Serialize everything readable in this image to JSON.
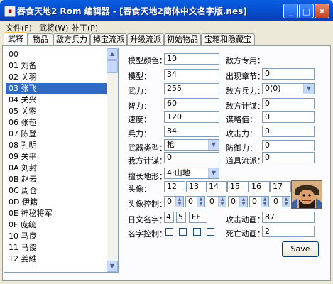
{
  "window": {
    "title": "吞食天地2 Rom 编辑器 - [吞食天地2简体中文名字版.nes]"
  },
  "menu": [
    "文件(F)",
    "武将(W)",
    "补丁(P)"
  ],
  "tabs": [
    "武将",
    "物品",
    "敌方兵力",
    "掉宝流派",
    "升级流派",
    "初始物品",
    "宝箱和隐藏宝物"
  ],
  "generals": [
    "00",
    "01 刘备",
    "02 关羽",
    "03 张飞",
    "04 关兴",
    "05 关索",
    "06 张苞",
    "07 陈登",
    "08 孔明",
    "09 关平",
    "0A 刘封",
    "0B 赵云",
    "0C 周仓",
    "0D 伊籍",
    "0E 神秘将军",
    "0F 庞统",
    "10 马良",
    "11 马谡",
    "12 姜維"
  ],
  "selected_general": "03 张飞",
  "form": {
    "model_color_label": "模型颜色：",
    "model_color": "10",
    "model_label": "模型：",
    "model": "34",
    "force_label": "武力：",
    "force": "255",
    "intel_label": "智力：",
    "intel": "60",
    "speed_label": "速度：",
    "speed": "120",
    "troops_label": "兵力：",
    "troops": "84",
    "weapon_type_label": "武器类型：",
    "weapon_type": "枪",
    "our_tactic_label": "我方计谋：",
    "our_tactic": "0",
    "terrain_label": "擅长地形：",
    "terrain": "4:山地",
    "enemy_only_label": "敌方专用：",
    "chapter_label": "出现章节：",
    "chapter": "0",
    "enemy_troops_label": "敌方兵力：",
    "enemy_troops": "0(0)",
    "enemy_tactic_label": "敌方计谋：",
    "enemy_tactic": "0",
    "strategy_label": "谋略值：",
    "strategy": "0",
    "attack_label": "攻击力：",
    "attack": "0",
    "defense_label": "防御力：",
    "defense": "0",
    "item_flow_label": "道具流派：",
    "item_flow": "0",
    "portrait_label": "头像：",
    "portraits": [
      "12",
      "13",
      "14",
      "15",
      "16",
      "17"
    ],
    "portrait_ctrl_label": "头像控制：",
    "portrait_ctrls": [
      "0",
      "0",
      "0",
      "0",
      "0",
      "0"
    ],
    "jp_name_label": "日文名字：",
    "jp_name": [
      "4",
      "5",
      "FF"
    ],
    "name_ctrl_label": "名字控制：",
    "attack_anim_label": "攻击动画：",
    "attack_anim": "87",
    "death_anim_label": "死亡动画：",
    "death_anim": "2",
    "save_label": "Save"
  }
}
